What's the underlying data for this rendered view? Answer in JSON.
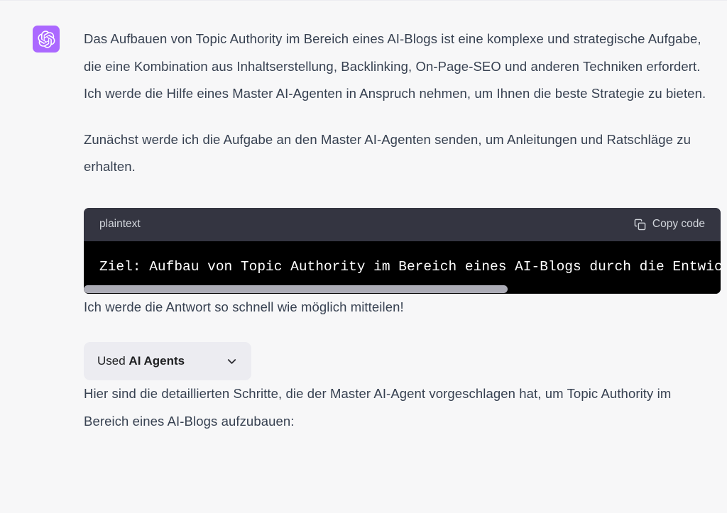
{
  "theme": {
    "page_background": "#f7f7f8",
    "text_color": "#374151",
    "avatar_background": "#ab68ff",
    "code_header_background": "#343541",
    "code_body_background": "#000000",
    "code_text_color": "#ffffff",
    "pill_background": "#ececf1",
    "scrollbar_thumb": "#acacb6"
  },
  "message": {
    "avatar_icon": "openai-logo-icon",
    "paragraphs": {
      "intro": "Das Aufbauen von Topic Authority im Bereich eines AI-Blogs ist eine komplexe und strategische Aufgabe, die eine Kombination aus Inhaltserstellung, Backlinking, On-Page-SEO und anderen Techniken erfordert. Ich werde die Hilfe eines Master AI-Agenten in Anspruch nehmen, um Ihnen die beste Strategie zu bieten.",
      "next_step": "Zunächst werde ich die Aufgabe an den Master AI-Agenten senden, um Anleitungen und Ratschläge zu erhalten.",
      "after_code": "Ich werde die Antwort so schnell wie möglich mitteilen!",
      "closing": "Hier sind die detaillierten Schritte, die der Master AI-Agent vorgeschlagen hat, um Topic Authority im Bereich eines AI-Blogs aufzubauen:"
    }
  },
  "code_block": {
    "language_label": "plaintext",
    "copy_button_label": "Copy code",
    "copy_button_icon": "clipboard-icon",
    "code_text": "Ziel: Aufbau von Topic Authority im Bereich eines AI-Blogs durch die Entwick",
    "scrollbar": {
      "orientation": "horizontal",
      "thumb_fraction": 0.66
    }
  },
  "used_tool": {
    "prefix_label": "Used",
    "tool_name": "AI Agents",
    "chevron_icon": "chevron-down-icon",
    "expanded": false
  }
}
